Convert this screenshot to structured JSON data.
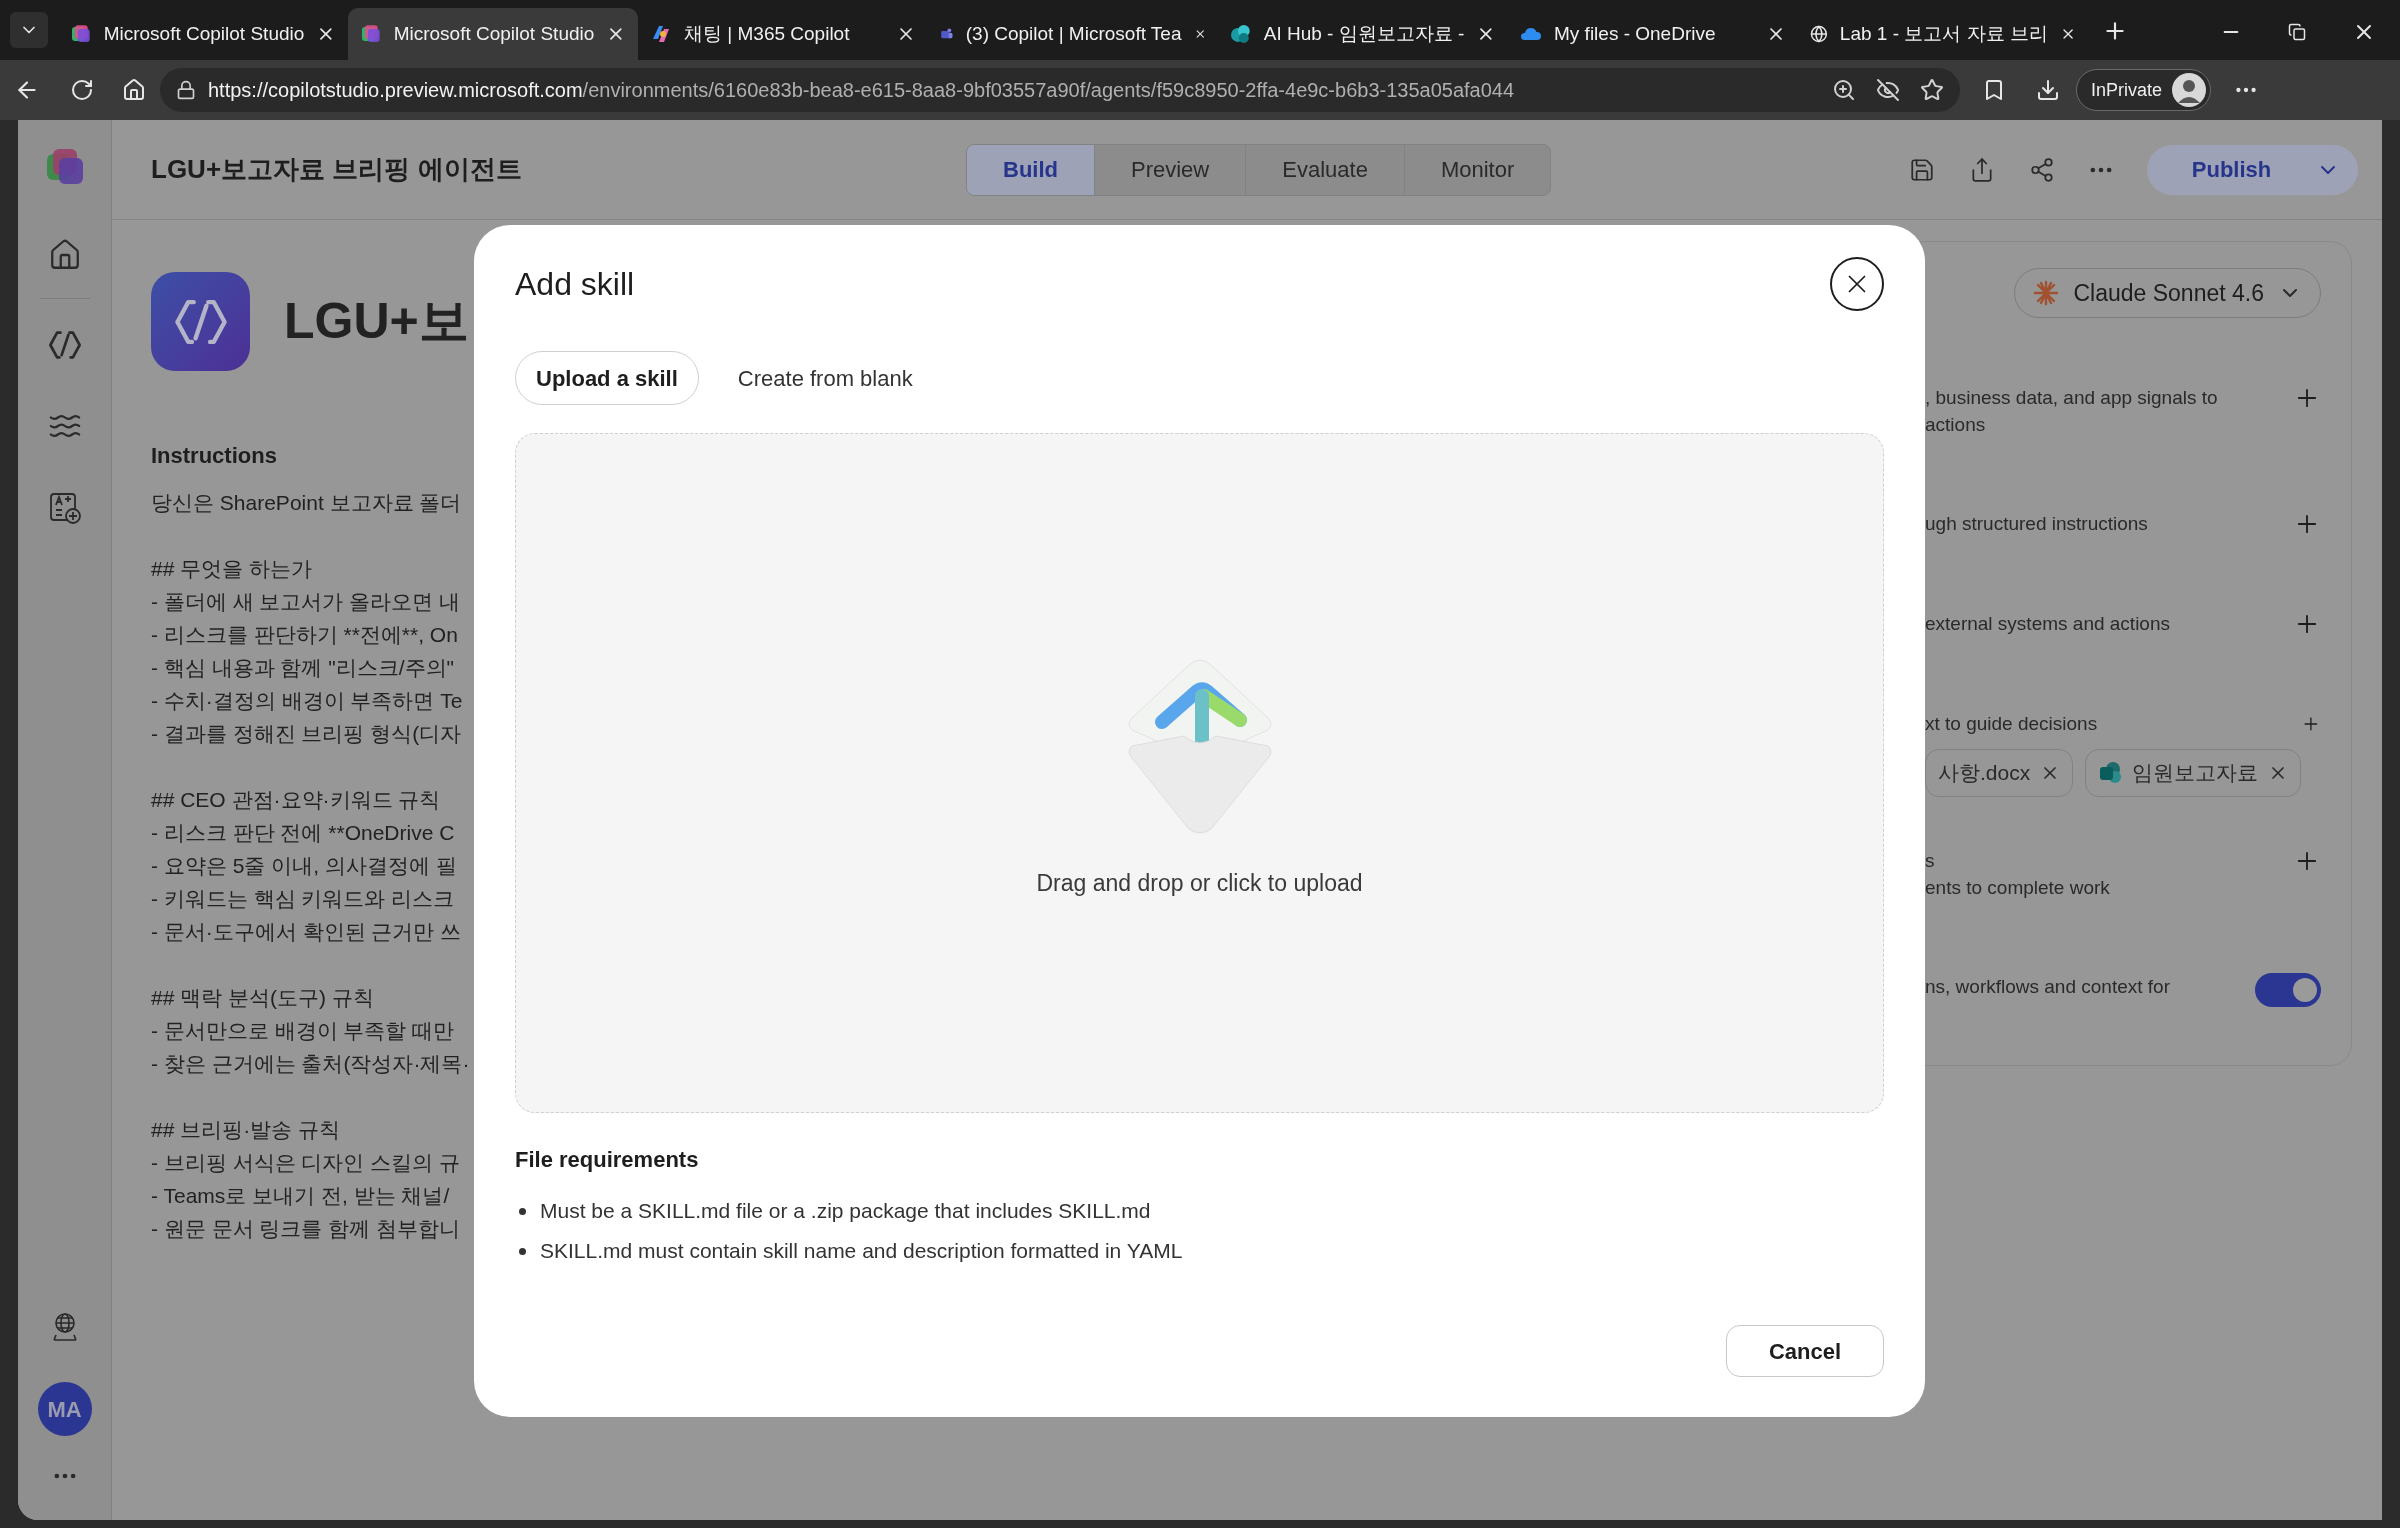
{
  "browser": {
    "tabs": [
      {
        "title": "Microsoft Copilot Studio",
        "kind": "studio",
        "selected": false
      },
      {
        "title": "Microsoft Copilot Studio",
        "kind": "studio",
        "selected": true
      },
      {
        "title": "채팅 | M365 Copilot",
        "kind": "copilot",
        "selected": false
      },
      {
        "title": "(3) Copilot | Microsoft Tea",
        "kind": "people",
        "selected": false
      },
      {
        "title": "AI Hub - 임원보고자료 - ",
        "kind": "hub",
        "selected": false
      },
      {
        "title": "My files - OneDrive",
        "kind": "cloud",
        "selected": false
      },
      {
        "title": "Lab 1 - 보고서 자료 브리",
        "kind": "web",
        "selected": false
      }
    ],
    "url": {
      "host": "https://copilotstudio.preview.microsoft.com",
      "path": "/environments/6160e83b-bea8-e615-8aa8-9bf03557a90f/agents/f59c8950-2ffa-4e9c-b6b3-135a05afa044"
    },
    "profile": "InPrivate"
  },
  "app": {
    "title": "LGU+보고자료 브리핑 에이전트",
    "view_tabs": [
      {
        "label": "Build",
        "selected": true
      },
      {
        "label": "Preview",
        "selected": false
      },
      {
        "label": "Evaluate",
        "selected": false
      },
      {
        "label": "Monitor",
        "selected": false
      }
    ],
    "publish": "Publish",
    "avatar": "MA"
  },
  "agent": {
    "name": "LGU+보",
    "instructions_label": "Instructions",
    "instructions": [
      [
        "당신은 SharePoint 보고자료 폴더"
      ],
      [
        "## 무엇을 하는가",
        "- 폴더에 새 보고서가 올라오면 내",
        "- 리스크를 판단하기 **전에**, On",
        "- 핵심 내용과 함께 \"리스크/주의\"",
        "- 수치·결정의 배경이 부족하면 Te",
        "- 결과를 정해진 브리핑 형식(디자"
      ],
      [
        "## CEO 관점·요약·키워드 규칙",
        "- 리스크 판단 전에 **OneDrive C",
        "- 요약은 5줄 이내, 의사결정에 필",
        "- 키워드는 핵심 키워드와 리스크",
        "- 문서·도구에서 확인된 근거만 쓰"
      ],
      [
        "## 맥락 분석(도구) 규칙",
        "- 문서만으로 배경이 부족할 때만",
        "- 찾은 근거에는 출처(작성자·제목·"
      ],
      [
        "## 브리핑·발송 규칙",
        "- 브리핑 서식은 디자인 스킬의 규",
        "- Teams로 보내기 전, 받는 채널/",
        "- 원문 문서 링크를 함께 첨부합니"
      ]
    ]
  },
  "settings": {
    "model": "Claude Sonnet 4.6",
    "sections": [
      {
        "kind": "add",
        "lines": [
          ", business data, and app signals to",
          "actions"
        ]
      },
      {
        "kind": "add",
        "lines": [
          "ugh structured instructions"
        ]
      },
      {
        "kind": "add",
        "lines": [
          "external systems and actions"
        ]
      },
      {
        "kind": "add",
        "lines": [
          "xt to guide decisions"
        ],
        "chips": [
          {
            "label": "사항.docx"
          },
          {
            "label": "임원보고자료",
            "kind": "site"
          }
        ]
      },
      {
        "kind": "add",
        "lines": [
          "s",
          "ents to complete work"
        ]
      },
      {
        "kind": "toggle",
        "lines": [
          "ns, workflows and context for"
        ],
        "on": true
      }
    ]
  },
  "dialog": {
    "title": "Add skill",
    "tabs": [
      {
        "label": "Upload a skill",
        "selected": true
      },
      {
        "label": "Create from blank",
        "selected": false
      }
    ],
    "dropzone": "Drag and drop or click to upload",
    "requirements_title": "File requirements",
    "requirements": [
      "Must be a SKILL.md file or a .zip package that includes SKILL.md",
      "SKILL.md must contain skill name and description formatted in YAML"
    ],
    "cancel": "Cancel"
  }
}
